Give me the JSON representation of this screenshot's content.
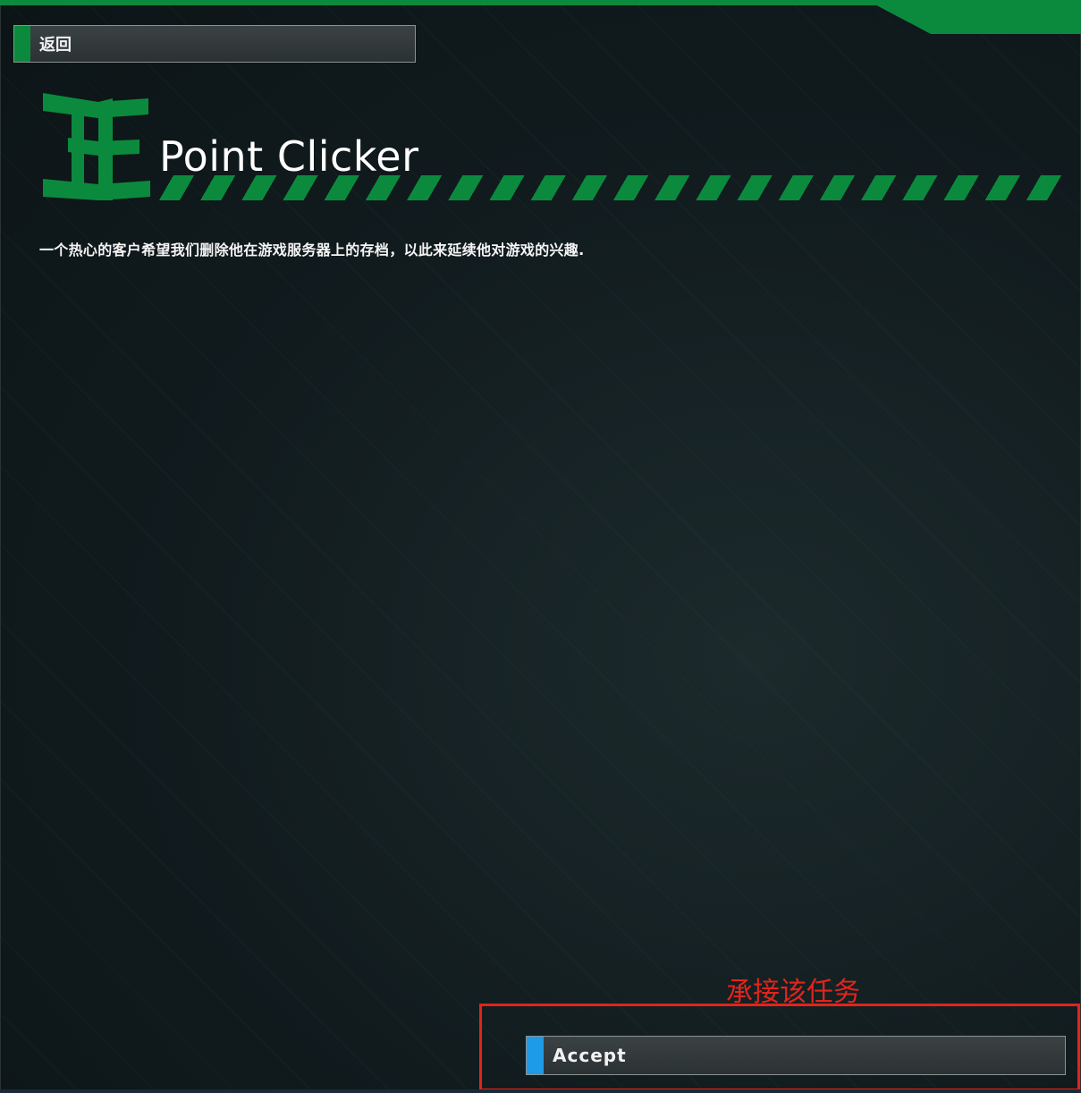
{
  "colors": {
    "accent_green": "#0b8a3d",
    "accept_blue": "#1d9be6",
    "annotation_red": "#e3241b"
  },
  "header": {
    "back_label": "返回"
  },
  "mission": {
    "logo_icon": "3e-logo-icon",
    "title": "Point Clicker",
    "description": "一个热心的客户希望我们删除他在游戏服务器上的存档，以此来延续他对游戏的兴趣."
  },
  "annotation": {
    "label": "承接该任务"
  },
  "footer": {
    "accept_label": "Accept"
  }
}
